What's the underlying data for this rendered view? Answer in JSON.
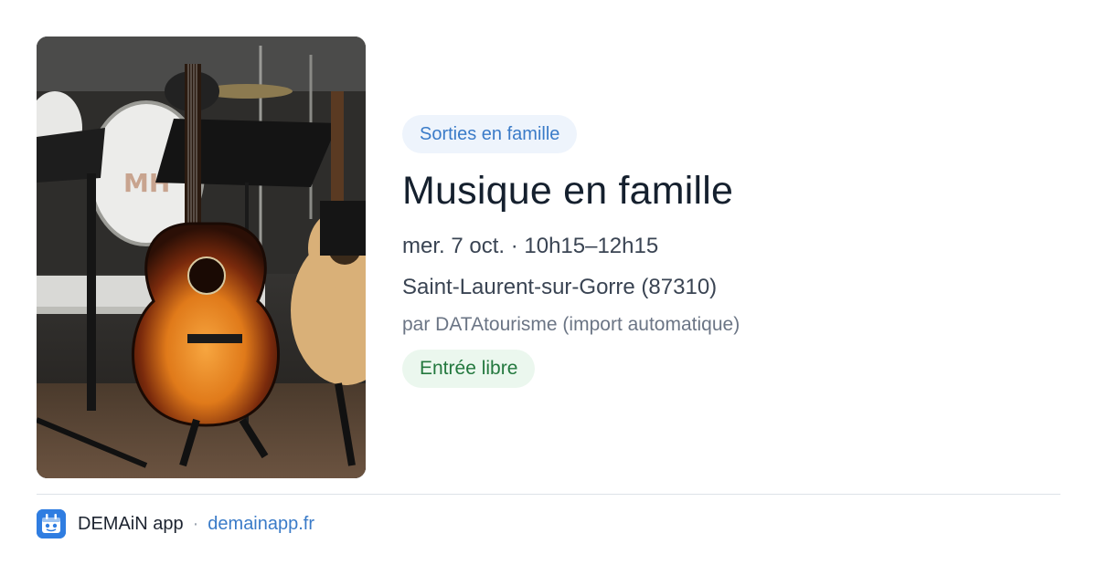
{
  "event": {
    "category": "Sorties en famille",
    "title": "Musique en famille",
    "datetime": "mer. 7 oct. · 10h15–12h15",
    "location": "Saint-Laurent-sur-Gorre (87310)",
    "source": "par DATAtourisme (import automatique)",
    "price": "Entrée libre",
    "image_icon": "guitar-photo"
  },
  "footer": {
    "app_name": "DEMAiN app",
    "separator": "·",
    "url": "demainapp.fr",
    "logo_icon": "demain-app-logo-icon"
  },
  "colors": {
    "category_bg": "#eef4fc",
    "category_text": "#3a7bc8",
    "price_bg": "#ebf7ee",
    "price_text": "#23783e",
    "title_text": "#15202e",
    "link": "#3a7bc8",
    "logo_bg": "#2f7de1"
  }
}
